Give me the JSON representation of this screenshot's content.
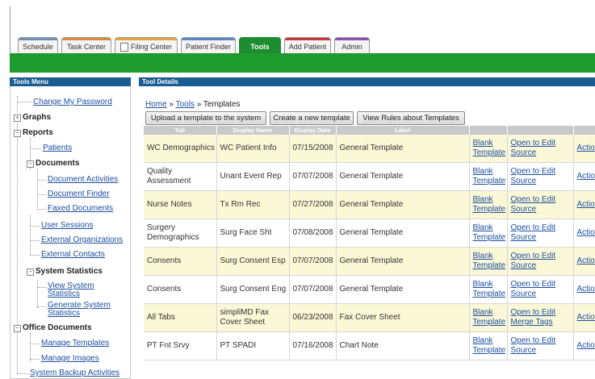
{
  "tabs": [
    {
      "label": "Schedule",
      "color": "#6d8fb8"
    },
    {
      "label": "Task Center",
      "color": "#d98a3a"
    },
    {
      "label": "Filing Center",
      "color": "#e4a53c"
    },
    {
      "label": "Patient Finder",
      "color": "#5b86c6"
    },
    {
      "label": "Tools",
      "color": "#1e8c30"
    },
    {
      "label": "Add Patient",
      "color": "#c83a3a"
    },
    {
      "label": "Admin",
      "color": "#8a4fb0"
    }
  ],
  "menu": {
    "title": "Tools Menu",
    "items": {
      "change_password": "Change My Password",
      "graphs": "Graphs",
      "reports": "Reports",
      "patients": "Patients",
      "documents": "Documents",
      "document_activities": "Document Activities",
      "document_finder": "Document Finder",
      "faxed_documents": "Faxed Documents",
      "user_sessions": "User Sessions",
      "external_organizations": "External Organizations",
      "external_contacts": "External Contacts",
      "system_statistics": "System Statistics",
      "view_system_statistics_1": "View System",
      "view_system_statistics_2": "Statistics",
      "generate_system_statistics_1": "Generate System",
      "generate_system_statistics_2": "Statistics",
      "office_documents": "Office Documents",
      "manage_templates": "Manage Templates",
      "manage_images": "Manage Images",
      "system_backup": "System Backup Activities"
    }
  },
  "details": {
    "title": "Tool Details",
    "breadcrumb": {
      "home": "Home",
      "sep1": " » ",
      "tools": "Tools",
      "sep2": " » ",
      "current": "Templates"
    },
    "buttons": {
      "upload": "Upload a template to the system",
      "create": "Create a new template",
      "rules": "View Rules about Templates"
    },
    "columns": [
      "Tab",
      "Display Name",
      "Display Date",
      "Label",
      "",
      "",
      ""
    ],
    "rows": [
      {
        "tab": "WC Demographics",
        "name": "WC Patient Info",
        "date": "07/15/2008",
        "label": "General Template",
        "blank1": "Blank",
        "blank2": "Template",
        "open1": "Open to Edit",
        "open2": "Source",
        "actions": "Actions"
      },
      {
        "tab": "Quality Assessment",
        "name": "Unant Event Rep",
        "date": "07/07/2008",
        "label": "General Template",
        "blank1": "Blank",
        "blank2": "Template",
        "open1": "Open to Edit",
        "open2": "Source",
        "actions": "Actions"
      },
      {
        "tab": "Nurse Notes",
        "name": "Tx Rm Rec",
        "date": "07/27/2008",
        "label": "General Template",
        "blank1": "Blank",
        "blank2": "Template",
        "open1": "Open to Edit",
        "open2": "Source",
        "actions": "Actions"
      },
      {
        "tab": "Surgery Demographics",
        "name": "Surg Face Sht",
        "date": "07/08/2008",
        "label": "General Template",
        "blank1": "Blank",
        "blank2": "Template",
        "open1": "Open to Edit",
        "open2": "Source",
        "actions": "Actions"
      },
      {
        "tab": "Consents",
        "name": "Surg Consent Esp",
        "date": "07/07/2008",
        "label": "General Template",
        "blank1": "Blank",
        "blank2": "Template",
        "open1": "Open to Edit",
        "open2": "Source",
        "actions": "Actions"
      },
      {
        "tab": "Consents",
        "name": "Surg Consent Eng",
        "date": "07/07/2008",
        "label": "General Template",
        "blank1": "Blank",
        "blank2": "Template",
        "open1": "Open to Edit",
        "open2": "Source",
        "actions": "Actions"
      },
      {
        "tab": "All Tabs",
        "name": "simpliMD Fax Cover Sheet",
        "date": "06/23/2008",
        "label": "Fax Cover Sheet",
        "blank1": "Blank",
        "blank2": "Template",
        "open1": "Open to Edit",
        "open2": "Merge Tags",
        "actions": "Actions"
      },
      {
        "tab": "PT Fnt Srvy",
        "name": "PT SPADI",
        "date": "07/16/2008",
        "label": "Chart Note",
        "blank1": "Blank",
        "blank2": "Template",
        "open1": "Open to Edit",
        "open2": "Source",
        "actions": "Actions"
      }
    ]
  },
  "colors": {
    "green_bar": "#1e9a2e",
    "panel_header": "#1a5d92",
    "row_highlight": "#fbf8d7",
    "link": "#1b4fa0"
  }
}
